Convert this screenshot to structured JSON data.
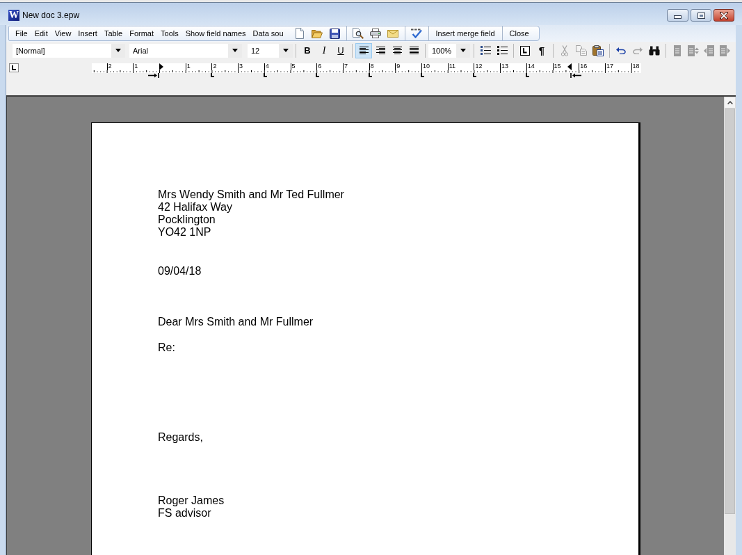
{
  "window": {
    "logo": "W",
    "title": "New doc 3.epw"
  },
  "menu": [
    "File",
    "Edit",
    "View",
    "Insert",
    "Table",
    "Format",
    "Tools",
    "Show field names",
    "Data sou"
  ],
  "mail_merge_toolbar": {
    "buttons": [
      "Insert merge field",
      "Close"
    ]
  },
  "format_toolbar": {
    "style": "[Normal]",
    "font": "Arial",
    "size": "12",
    "text_style_buttons": [
      {
        "kind": "bold",
        "label": "B"
      },
      {
        "kind": "italic",
        "label": "I"
      },
      {
        "kind": "underline",
        "label": "U"
      }
    ],
    "alignment": [
      {
        "selected": true
      },
      {
        "selected": false
      },
      {
        "selected": false
      },
      {
        "selected": false
      }
    ],
    "zoom": "100%",
    "paragraph_marks": "¶",
    "clipboard": [
      {
        "disabled": true
      },
      {
        "disabled": true
      },
      {
        "disabled": false
      }
    ],
    "history": [
      {
        "disabled": false
      },
      {
        "disabled": true
      }
    ],
    "table_tools": [
      {
        "disabled": true
      },
      {
        "disabled": true
      },
      {
        "disabled": true
      },
      {
        "disabled": true
      }
    ]
  },
  "ruler": {
    "left_margin_labels": [
      "2",
      "1"
    ],
    "labels": [
      "1",
      "2",
      "3",
      "4",
      "5",
      "6",
      "7",
      "8",
      "9",
      "10",
      "11",
      "12",
      "13",
      "14",
      "15",
      "16",
      "17",
      "18"
    ]
  },
  "letter": {
    "address": [
      "Mrs Wendy Smith and Mr Ted Fullmer",
      "42 Halifax Way",
      "Pocklington",
      "YO42 1NP"
    ],
    "date": "09/04/18",
    "salutation": "Dear Mrs Smith and Mr Fullmer",
    "subject": "Re:",
    "closing": "Regards,",
    "signature": [
      "Roger James",
      "FS advisor"
    ]
  }
}
